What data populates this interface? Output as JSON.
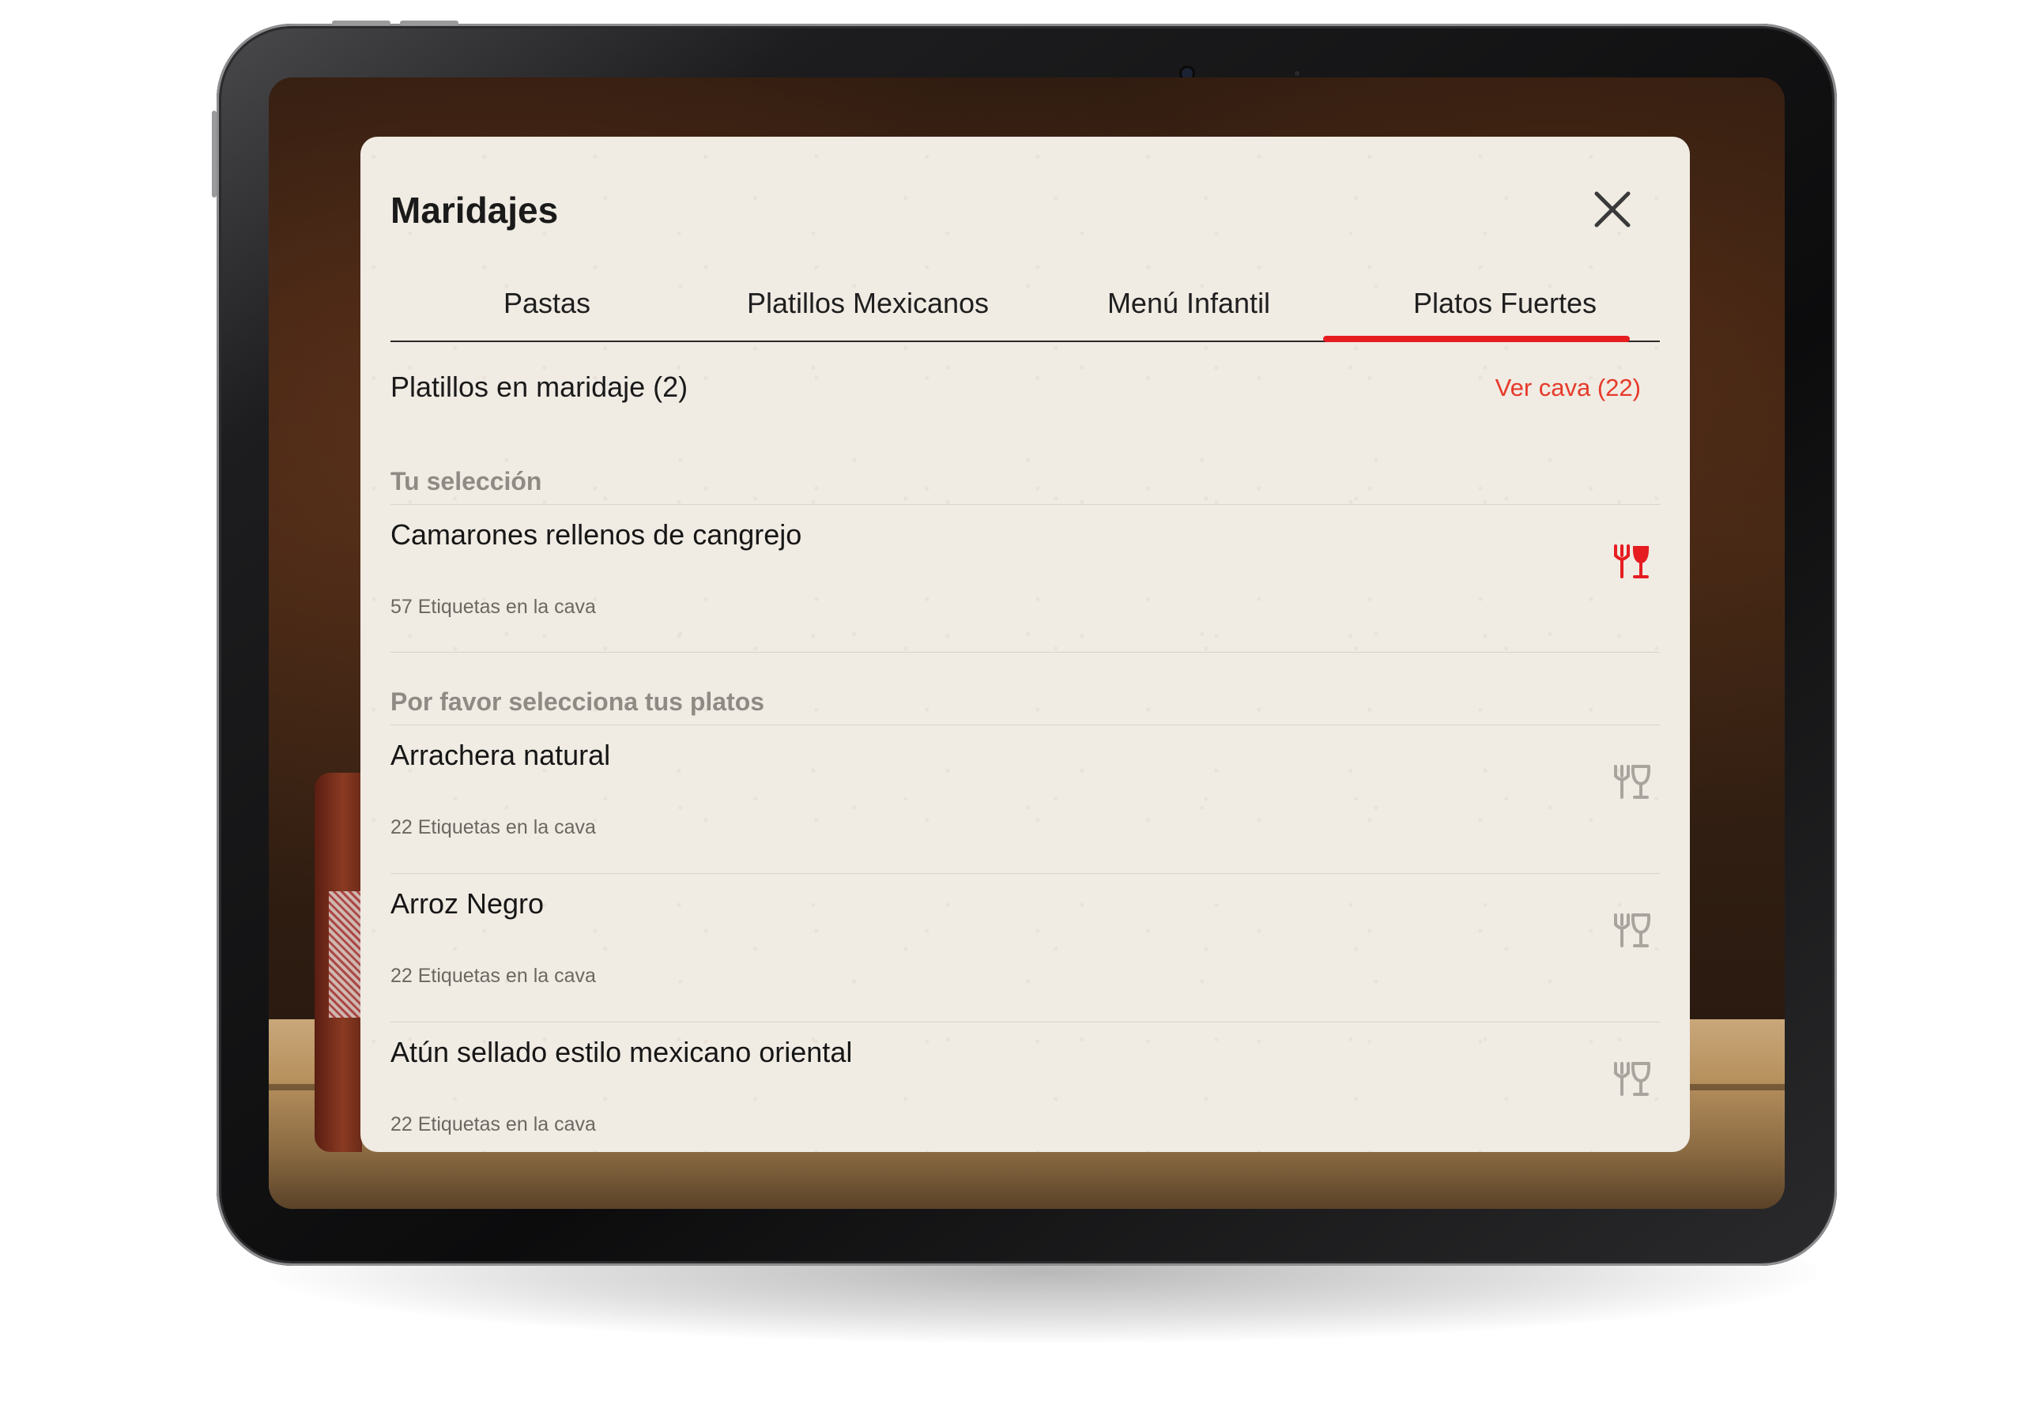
{
  "modal": {
    "title": "Maridajes"
  },
  "tabs": [
    {
      "label": "Pastas",
      "active": false
    },
    {
      "label": "Platillos Mexicanos",
      "active": false
    },
    {
      "label": "Menú Infantil",
      "active": false
    },
    {
      "label": "Platos Fuertes",
      "active": true
    }
  ],
  "summary": {
    "label": "Platillos en maridaje (2)",
    "cava_link": "Ver cava (22)"
  },
  "sections": {
    "selected_header": "Tu selección",
    "unselected_header": "Por favor selecciona tus platos"
  },
  "selected_dishes": [
    {
      "name": "Camarones rellenos de cangrejo",
      "count": "57 Etiquetas en la cava",
      "icon": "fork-wine-glass-icon"
    }
  ],
  "dishes": [
    {
      "name": "Arrachera natural",
      "count": "22 Etiquetas en la cava",
      "icon": "fork-wine-glass-icon"
    },
    {
      "name": "Arroz Negro",
      "count": "22 Etiquetas en la cava",
      "icon": "fork-wine-glass-icon"
    },
    {
      "name": "Atún sellado estilo mexicano oriental",
      "count": "22 Etiquetas en la cava",
      "icon": "fork-wine-glass-icon"
    }
  ],
  "colors": {
    "accent": "#e51d21",
    "link": "#e63a2a",
    "icon_inactive": "#a9a49e",
    "modal_background": "#f0ebe3"
  }
}
